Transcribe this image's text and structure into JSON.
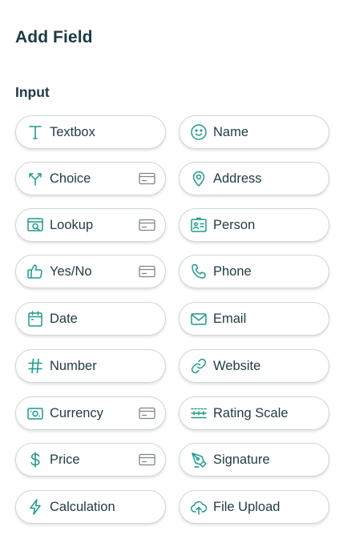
{
  "panel": {
    "title": "Add Field",
    "section_label": "Input"
  },
  "accent_color": "#1f9a8c",
  "fields": [
    {
      "label": "Textbox",
      "icon": "text-icon",
      "card": false
    },
    {
      "label": "Name",
      "icon": "smiley-icon",
      "card": false
    },
    {
      "label": "Choice",
      "icon": "branch-arrows-icon",
      "card": true
    },
    {
      "label": "Address",
      "icon": "map-pin-icon",
      "card": false
    },
    {
      "label": "Lookup",
      "icon": "lookup-icon",
      "card": true
    },
    {
      "label": "Person",
      "icon": "contact-card-icon",
      "card": false
    },
    {
      "label": "Yes/No",
      "icon": "thumbs-up-icon",
      "card": true
    },
    {
      "label": "Phone",
      "icon": "phone-icon",
      "card": false
    },
    {
      "label": "Date",
      "icon": "calendar-icon",
      "card": false
    },
    {
      "label": "Email",
      "icon": "envelope-icon",
      "card": false
    },
    {
      "label": "Number",
      "icon": "hash-icon",
      "card": false
    },
    {
      "label": "Website",
      "icon": "link-icon",
      "card": false
    },
    {
      "label": "Currency",
      "icon": "banknote-icon",
      "card": true
    },
    {
      "label": "Rating Scale",
      "icon": "rating-scale-icon",
      "card": false
    },
    {
      "label": "Price",
      "icon": "dollar-icon",
      "card": true
    },
    {
      "label": "Signature",
      "icon": "pen-icon",
      "card": false
    },
    {
      "label": "Calculation",
      "icon": "lightning-icon",
      "card": false
    },
    {
      "label": "File Upload",
      "icon": "cloud-upload-icon",
      "card": false
    }
  ]
}
